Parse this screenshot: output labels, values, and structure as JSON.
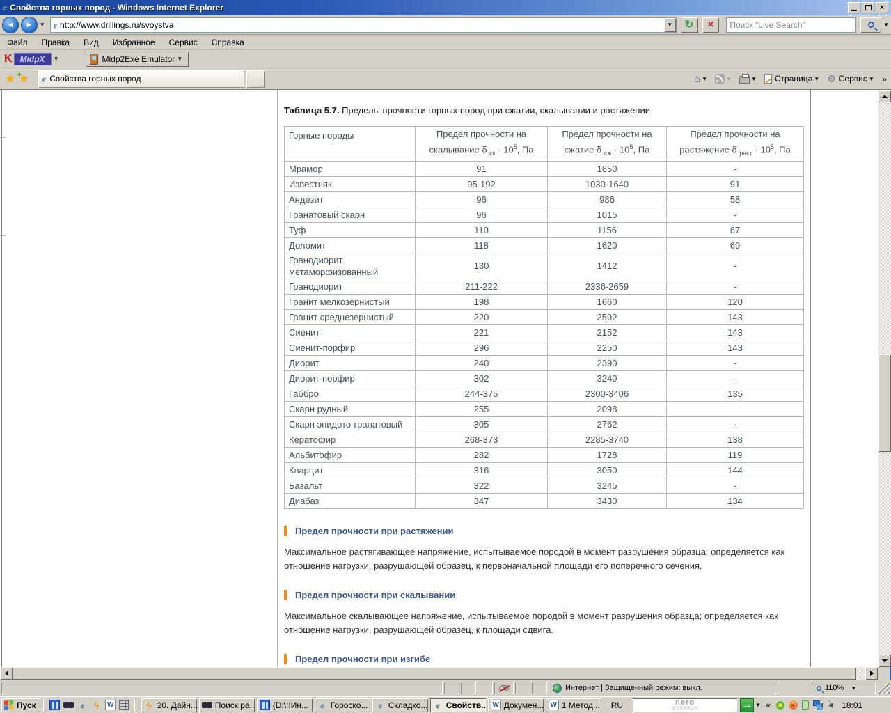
{
  "icons": {
    "ie": "e",
    "caret": "▼",
    "back_arrow": "◄",
    "fwd_arrow": "►",
    "refresh": "↻",
    "stop": "×",
    "close": "×",
    "star": "★",
    "plus": "+",
    "home": "⌂",
    "gear": "⚙",
    "overflow": "»",
    "tray_collapse": "«",
    "word": "W",
    "lightning": "ϟ",
    "arrow_right": "→"
  },
  "window": {
    "title": "Свойства горных пород - Windows Internet Explorer"
  },
  "address": {
    "url": "http://www.drillings.ru/svoystva",
    "search_placeholder": "Поиск \"Live Search\""
  },
  "menu": {
    "items": [
      "Файл",
      "Правка",
      "Вид",
      "Избранное",
      "Сервис",
      "Справка"
    ]
  },
  "toolbar": {
    "midpx_k": "K",
    "midpx_label": "MidpX",
    "emulator_label": "Midp2Exe Emulator"
  },
  "tabs": {
    "active_label": "Свойства горных пород"
  },
  "commandbar": {
    "page_label": "Страница",
    "tools_label": "Сервис"
  },
  "content": {
    "caption_bold": "Таблица 5.7.",
    "caption_rest": " Пределы прочности горных пород при сжатии, скалывании и растяжении",
    "table": {
      "col0_header": "Горные породы",
      "headers": [
        {
          "line1": "Предел прочности на",
          "line2": "скалывание δ ",
          "sub": "ск",
          "mid": " · 10",
          "sup": "5",
          "post": ", Па"
        },
        {
          "line1": "Предел прочности на",
          "line2": "сжатие δ ",
          "sub": "сж",
          "mid": " · 10",
          "sup": "5",
          "post": ", Па"
        },
        {
          "line1": "Предел прочности на",
          "line2": "растяжение δ ",
          "sub": "раст",
          "mid": " · 10",
          "sup": "5",
          "post": ", Па"
        }
      ],
      "rows": [
        {
          "name": "Мрамор",
          "shear": "91",
          "compression": "1650",
          "tension": "-"
        },
        {
          "name": "Известняк",
          "shear": "95-192",
          "compression": "1030-1640",
          "tension": "91"
        },
        {
          "name": "Андезит",
          "shear": "96",
          "compression": "986",
          "tension": "58"
        },
        {
          "name": "Гранатовый скарн",
          "shear": "96",
          "compression": "1015",
          "tension": "-"
        },
        {
          "name": "Туф",
          "shear": "110",
          "compression": "1156",
          "tension": "67"
        },
        {
          "name": "Доломит",
          "shear": "118",
          "compression": "1620",
          "tension": "69"
        },
        {
          "name": "Гранодиорит метаморфизованный",
          "shear": "130",
          "compression": "1412",
          "tension": "-"
        },
        {
          "name": "Гранодиорит",
          "shear": "211-222",
          "compression": "2336-2659",
          "tension": "-"
        },
        {
          "name": "Гранит мелкозернистый",
          "shear": "198",
          "compression": "1660",
          "tension": "120"
        },
        {
          "name": "Гранит среднезернистый",
          "shear": "220",
          "compression": "2592",
          "tension": "143"
        },
        {
          "name": "Сиенит",
          "shear": "221",
          "compression": "2152",
          "tension": "143"
        },
        {
          "name": "Сиенит-порфир",
          "shear": "296",
          "compression": "2250",
          "tension": "143"
        },
        {
          "name": "Диорит",
          "shear": "240",
          "compression": "2390",
          "tension": "-"
        },
        {
          "name": "Диорит-порфир",
          "shear": "302",
          "compression": "3240",
          "tension": "-"
        },
        {
          "name": "Габбро",
          "shear": "244-375",
          "compression": "2300-3406",
          "tension": "135"
        },
        {
          "name": "Скарн рудный",
          "shear": "255",
          "compression": "2098",
          "tension": ""
        },
        {
          "name": "Скарн эпидото-гранатовый",
          "shear": "305",
          "compression": "2762",
          "tension": "-"
        },
        {
          "name": "Кератофир",
          "shear": "268-373",
          "compression": "2285-3740",
          "tension": "138"
        },
        {
          "name": "Альбитофир",
          "shear": "282",
          "compression": "1728",
          "tension": "119"
        },
        {
          "name": "Кварцит",
          "shear": "316",
          "compression": "3050",
          "tension": "144"
        },
        {
          "name": "Базальт",
          "shear": "322",
          "compression": "3245",
          "tension": "-"
        },
        {
          "name": "Диабаз",
          "shear": "347",
          "compression": "3430",
          "tension": "134"
        }
      ]
    },
    "sections": [
      {
        "heading": "Предел прочности при растяжении",
        "text": "Максимальное растягивающее напряжение, испытываемое породой в момент разрушения образца: определяется как отношение нагрузки, разрушающей образец, к первоначальной площади его поперечного сечения."
      },
      {
        "heading": "Предел прочности при скалывании",
        "text": "Максимальное скалывающее напряжение, испытываемое породой в момент разрушения образца; определяется как отношение нагрузки, разрушающей образец, к площади сдвига."
      },
      {
        "heading": "Предел прочности при изгибе",
        "text": ""
      }
    ]
  },
  "statusbar": {
    "zone_text": "Интернет | Защищенный режим: выкл.",
    "zoom": "110%"
  },
  "taskbar": {
    "start_label": "Пуск",
    "buttons": [
      {
        "icon": "lightning",
        "label": "20. Дайн..."
      },
      {
        "icon": "binoc",
        "label": "Поиск ра..."
      },
      {
        "icon": "panel",
        "label": "{D:\\!!Ин..."
      },
      {
        "icon": "ie",
        "label": "Гороско..."
      },
      {
        "icon": "ie",
        "label": "Складко..."
      },
      {
        "icon": "ie",
        "label": "Свойств...",
        "active": true
      },
      {
        "icon": "word",
        "label": "Докумен..."
      },
      {
        "icon": "word",
        "label": "1 Метод..."
      }
    ],
    "lang": "RU",
    "nero_line1": "nero",
    "nero_line2": "@SEARCH",
    "clock": "18:01"
  }
}
